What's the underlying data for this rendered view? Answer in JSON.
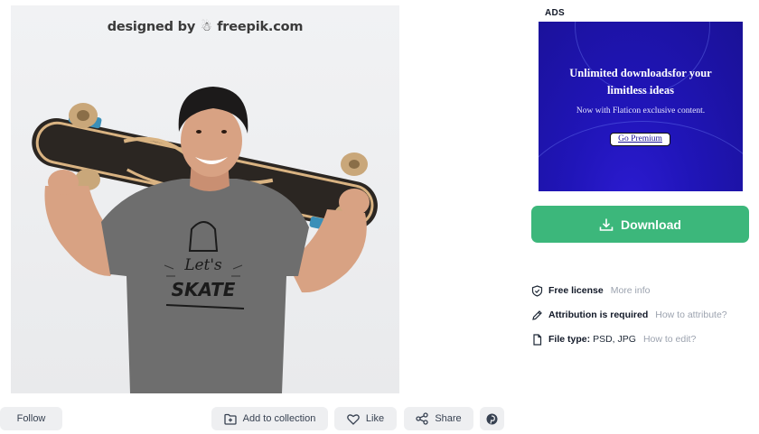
{
  "preview": {
    "watermark_prefix": "designed by",
    "watermark_brand": "freepik.com",
    "shirt_text_line1": "Let's",
    "shirt_text_line2": "SKATE"
  },
  "actions": {
    "follow_label": "Follow",
    "add_to_collection_label": "Add to collection",
    "like_label": "Like",
    "share_label": "Share"
  },
  "ads": {
    "label": "ADS",
    "headline_line1": "Unlimited downloadsfor your",
    "headline_line2": "limitless ideas",
    "subtext": "Now with Flaticon exclusive content.",
    "cta": "Go Premium"
  },
  "download": {
    "label": "Download",
    "color": "#3cb77b"
  },
  "info": {
    "license": {
      "label": "Free license",
      "link": "More info"
    },
    "attribution": {
      "label": "Attribution is required",
      "link": "How to attribute?"
    },
    "file_type": {
      "label": "File type:",
      "value": "PSD, JPG",
      "link": "How to edit?"
    }
  }
}
